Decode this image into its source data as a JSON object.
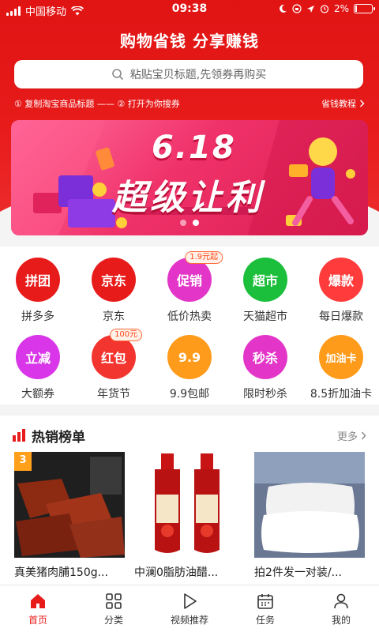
{
  "status_bar": {
    "carrier": "中国移动",
    "time": "09:38",
    "battery": "2%"
  },
  "header": {
    "title": "购物省钱  分享赚钱",
    "search_placeholder": "粘贴宝贝标题,先领券再购买",
    "steps_text": "① 复制淘宝商品标题 —— ② 打开为你搜券",
    "tutorial_label": "省钱教程"
  },
  "banner": {
    "headline": "6.18",
    "subline": "超级让利",
    "page_count": 2,
    "active_index": 1
  },
  "categories": [
    {
      "icon_text": "拼团",
      "label": "拼多多",
      "color": "#e81b1b",
      "icon": "pintuan-icon"
    },
    {
      "icon_text": "京东",
      "label": "京东",
      "color": "#e81b1b",
      "icon": "jd-icon"
    },
    {
      "icon_text": "促销",
      "label": "低价热卖",
      "color": "#e336c8",
      "icon": "promo-icon",
      "badge": "1.9元起"
    },
    {
      "icon_text": "超市",
      "label": "天猫超市",
      "color": "#1bbf3c",
      "icon": "market-icon"
    },
    {
      "icon_text": "爆款",
      "label": "每日爆款",
      "color": "#ff3b3b",
      "icon": "hot-icon"
    },
    {
      "icon_text": "立减",
      "label": "大额券",
      "color": "#d836e8",
      "icon": "coupon-icon"
    },
    {
      "icon_text": "红包",
      "label": "年货节",
      "color": "#f2352f",
      "icon": "redpacket-icon",
      "badge": "100元"
    },
    {
      "icon_text": "9.9",
      "label": "9.9包邮",
      "color": "#ff9b1a",
      "icon": "bag-icon"
    },
    {
      "icon_text": "秒杀",
      "label": "限时秒杀",
      "color": "#e336c8",
      "icon": "flash-icon"
    },
    {
      "icon_text": "加油卡",
      "label": "8.5折加油卡",
      "color": "#ff9b1a",
      "icon": "fuel-icon"
    }
  ],
  "hot_list": {
    "title": "热销榜单",
    "more_label": "更多",
    "products": [
      {
        "rank": "3",
        "name": "真美猪肉脯150g..."
      },
      {
        "rank": "",
        "name": "中澜0脂肪油醋..."
      },
      {
        "rank": "",
        "name": "拍2件发一对装/..."
      }
    ]
  },
  "tabbar": [
    {
      "label": "首页",
      "icon": "home-icon",
      "active": true
    },
    {
      "label": "分类",
      "icon": "grid-icon",
      "active": false
    },
    {
      "label": "视频推荐",
      "icon": "play-icon",
      "active": false
    },
    {
      "label": "任务",
      "icon": "calendar-icon",
      "active": false
    },
    {
      "label": "我的",
      "icon": "user-icon",
      "active": false
    }
  ],
  "colors": {
    "brand_red": "#e81b1b",
    "background": "#f4f4f4"
  }
}
